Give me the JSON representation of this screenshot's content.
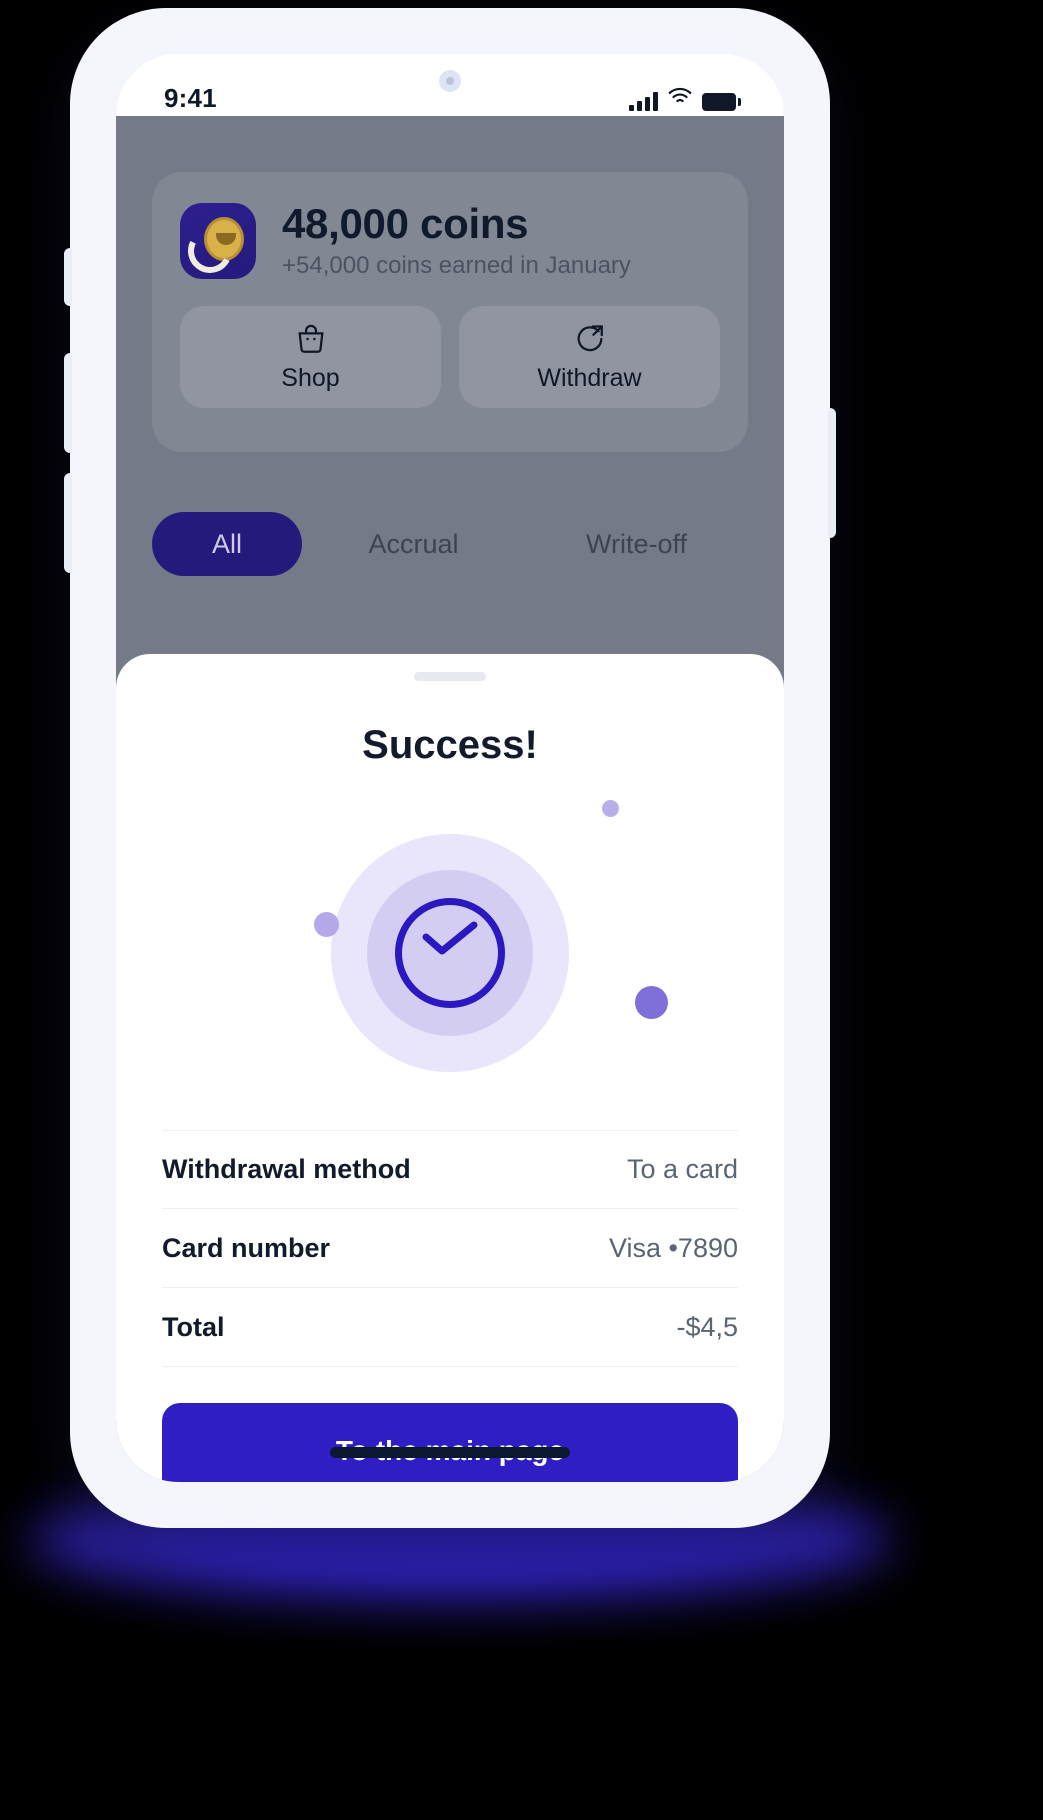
{
  "device": {
    "status_bar": {
      "time": "9:41",
      "signal_icon": "cellular-signal-icon",
      "wifi_icon": "wifi-icon",
      "battery_icon": "battery-full-icon"
    },
    "home_indicator": "home-indicator"
  },
  "app": {
    "coin_card": {
      "badge_icon": "coin-badge-icon",
      "amount": "48,000 coins",
      "subtitle": "+54,000 coins earned in January",
      "actions": [
        {
          "label": "Shop",
          "icon": "shopping-bag-icon"
        },
        {
          "label": "Withdraw",
          "icon": "withdraw-arrow-icon"
        }
      ]
    },
    "tabs": [
      {
        "label": "All",
        "active": true
      },
      {
        "label": "Accrual",
        "active": false
      },
      {
        "label": "Write-off",
        "active": false
      }
    ]
  },
  "sheet": {
    "handle": "drag-handle",
    "title": "Success!",
    "illustration": {
      "check_icon": "check-circle-icon",
      "dots": [
        "decorative-dot",
        "decorative-dot",
        "decorative-dot"
      ]
    },
    "details": [
      {
        "label": "Withdrawal method",
        "value": "To a card"
      },
      {
        "label": "Card number",
        "value": "Visa •7890"
      },
      {
        "label": "Total",
        "value": "-$4,5"
      }
    ],
    "primary_button": "To the main page"
  },
  "colors": {
    "brand_primary": "#2f1ec4",
    "brand_dark": "#241a7b",
    "check_indigo": "#2a18c0",
    "ring_outer": "#e9e5fa",
    "ring_inner": "#d4cdf2",
    "dim_overlay": "#747a88",
    "text_dark": "#121a2b",
    "text_muted": "#5b6472",
    "divider": "#eef0f4"
  }
}
